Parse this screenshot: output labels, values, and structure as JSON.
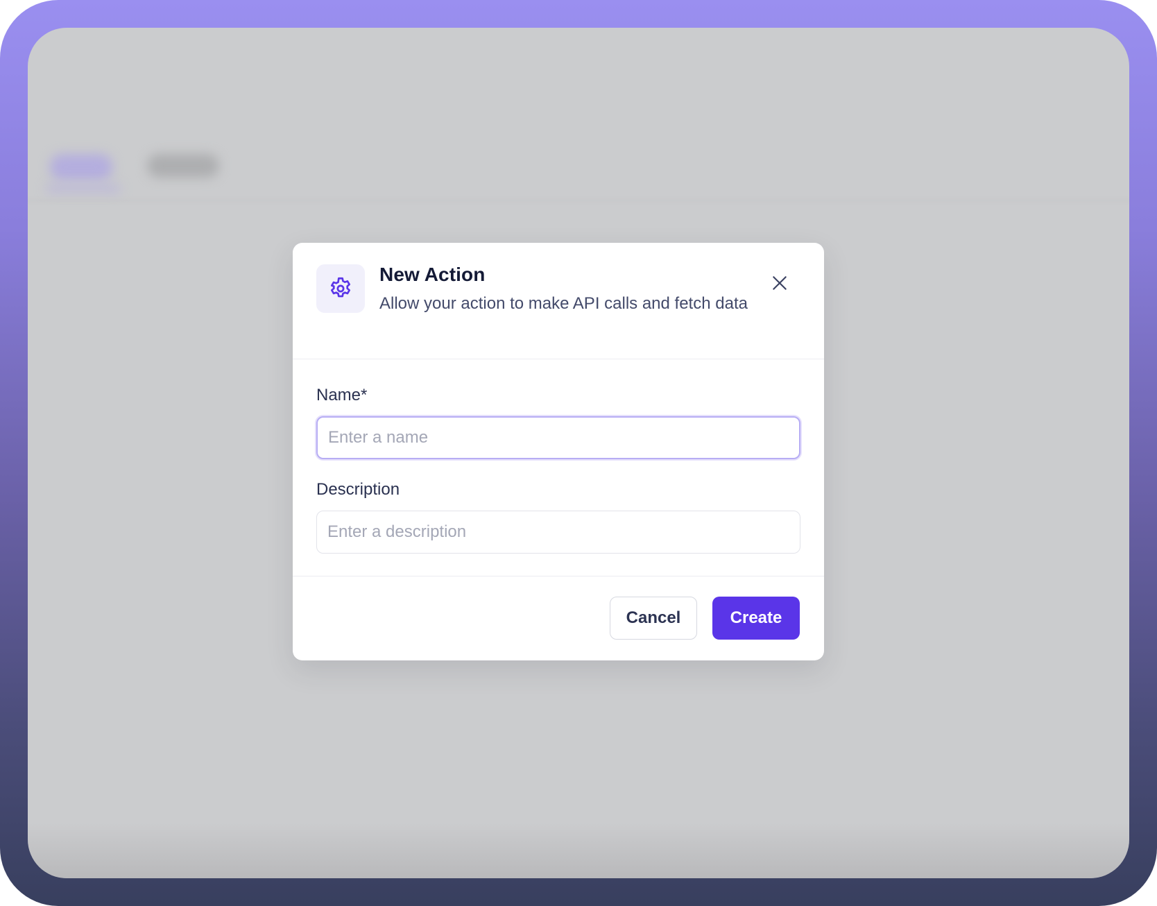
{
  "background": {
    "frame_gradient_top": "#9a8ff0",
    "frame_gradient_bottom": "#383f5e",
    "screen_color": "#cbccce"
  },
  "modal": {
    "icon": "gear-icon",
    "title": "New Action",
    "subtitle": "Allow your action to make API calls and fetch data",
    "close_icon": "close-icon",
    "fields": {
      "name": {
        "label": "Name*",
        "value": "",
        "placeholder": "Enter a name",
        "focused": true
      },
      "description": {
        "label": "Description",
        "value": "",
        "placeholder": "Enter a description"
      }
    },
    "buttons": {
      "cancel_label": "Cancel",
      "create_label": "Create"
    },
    "accent_color": "#5a35e8"
  }
}
